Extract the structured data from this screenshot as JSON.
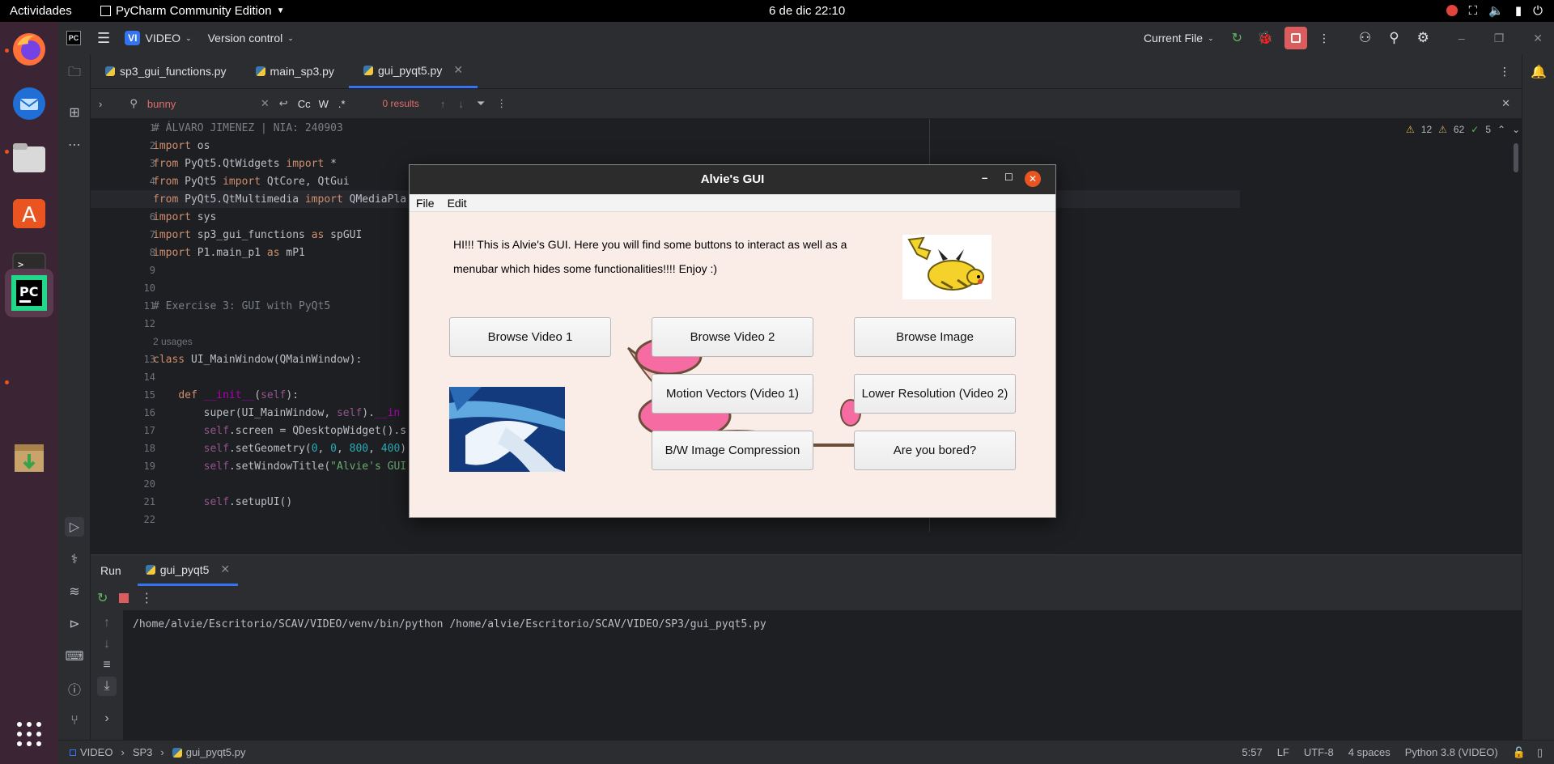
{
  "topbar": {
    "activities": "Actividades",
    "app_name": "PyCharm Community Edition",
    "clock": "6 de dic  22:10"
  },
  "ide": {
    "logo": "PC",
    "project_badge": "VI",
    "project_name": "VIDEO",
    "vcs": "Version control",
    "run_config": "Current File",
    "tabs": [
      {
        "label": "sp3_gui_functions.py"
      },
      {
        "label": "main_sp3.py"
      },
      {
        "label": "gui_pyqt5.py"
      }
    ],
    "find": {
      "query": "bunny",
      "results": "0 results",
      "cc": "Cc",
      "w": "W",
      "regex": ".*"
    },
    "inspections": {
      "warnings": "12",
      "weak": "62",
      "ok": "5"
    },
    "usages_hint": "2 usages",
    "line_numbers": [
      "1",
      "2",
      "3",
      "4",
      "5",
      "6",
      "7",
      "8",
      "9",
      "10",
      "11",
      "12",
      "13",
      "14",
      "15",
      "16",
      "17",
      "18",
      "19",
      "20",
      "21",
      "22"
    ]
  },
  "run": {
    "tab_run": "Run",
    "tab_file": "gui_pyqt5",
    "output": "/home/alvie/Escritorio/SCAV/VIDEO/venv/bin/python /home/alvie/Escritorio/SCAV/VIDEO/SP3/gui_pyqt5.py"
  },
  "status": {
    "crumb_project": "VIDEO",
    "crumb_dir": "SP3",
    "crumb_file": "gui_pyqt5.py",
    "position": "5:57",
    "line_sep": "LF",
    "encoding": "UTF-8",
    "indent": "4 spaces",
    "interpreter": "Python 3.8 (VIDEO)"
  },
  "qt": {
    "title": "Alvie's GUI",
    "menu_file": "File",
    "menu_edit": "Edit",
    "intro_line1": "HI!!! This is Alvie's GUI. Here you will find some buttons to interact as well as a",
    "intro_line2": "menubar which hides some functionalities!!!! Enjoy :)",
    "buttons": {
      "browse1": "Browse Video 1",
      "browse2": "Browse Video 2",
      "browse_img": "Browse Image",
      "motion": "Motion Vectors (Video 1)",
      "lowres": "Lower Resolution (Video 2)",
      "bw": "B/W Image Compression",
      "bored": "Are you bored?"
    }
  },
  "colors": {
    "accent": "#3574f0",
    "ubuntu_orange": "#e95420",
    "qt_bg": "#faece7"
  }
}
